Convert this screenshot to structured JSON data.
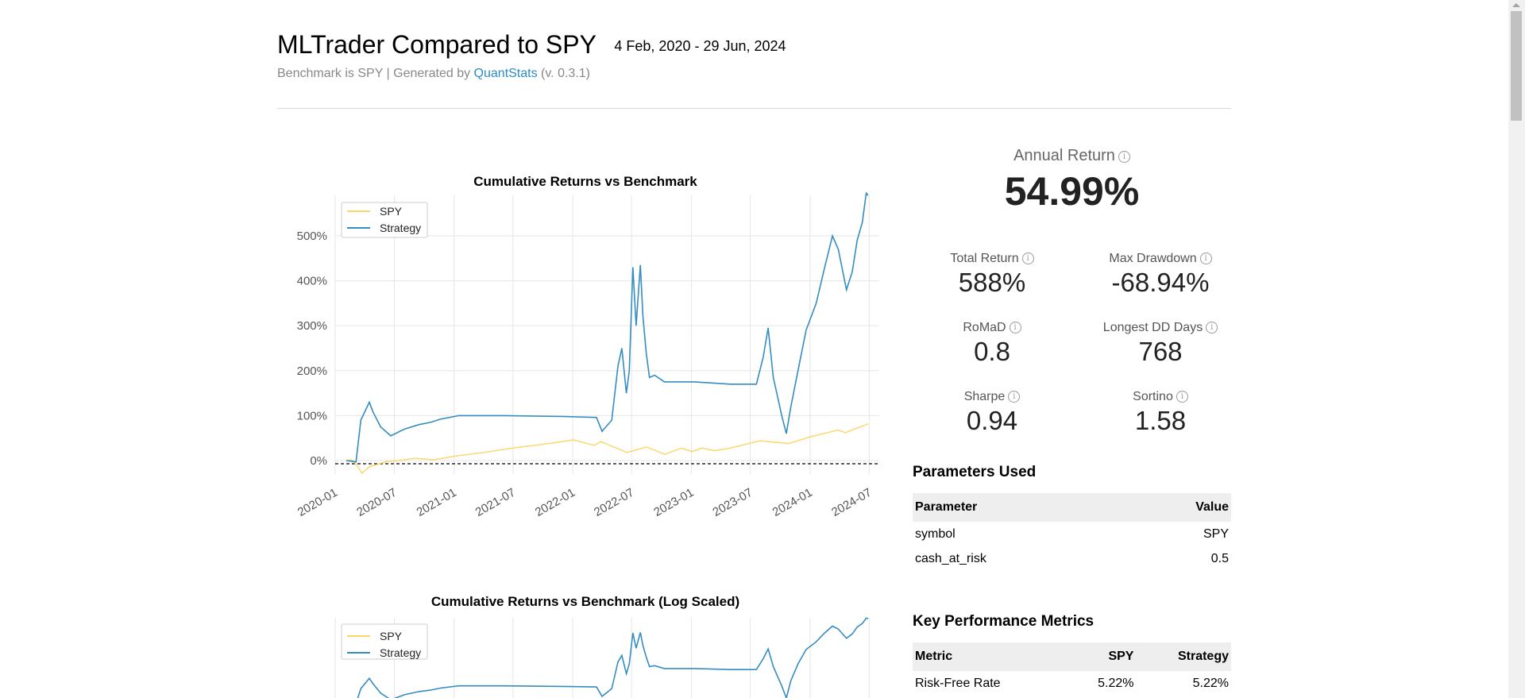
{
  "header": {
    "title": "MLTrader Compared to SPY",
    "date_range": "4 Feb, 2020 - 29 Jun, 2024",
    "subtitle_prefix": "Benchmark is SPY | Generated by ",
    "subtitle_link": "QuantStats",
    "subtitle_suffix": " (v. 0.3.1)"
  },
  "summary": {
    "annual_return": {
      "label": "Annual Return",
      "value": "54.99%"
    },
    "metrics": [
      {
        "label": "Total Return",
        "value": "588%"
      },
      {
        "label": "Max Drawdown",
        "value": "-68.94%"
      },
      {
        "label": "RoMaD",
        "value": "0.8"
      },
      {
        "label": "Longest DD Days",
        "value": "768"
      },
      {
        "label": "Sharpe",
        "value": "0.94"
      },
      {
        "label": "Sortino",
        "value": "1.58"
      }
    ],
    "info_icon": "ⓘ"
  },
  "parameters": {
    "heading": "Parameters Used",
    "columns": [
      "Parameter",
      "Value"
    ],
    "rows": [
      [
        "symbol",
        "SPY"
      ],
      [
        "cash_at_risk",
        "0.5"
      ]
    ]
  },
  "key_metrics": {
    "heading": "Key Performance Metrics",
    "columns": [
      "Metric",
      "SPY",
      "Strategy"
    ],
    "rows": [
      [
        "Risk-Free Rate",
        "5.22%",
        "5.22%"
      ]
    ]
  },
  "colors": {
    "spy": "#fcd565",
    "strategy": "#348dc1",
    "grid": "#e6e6e6"
  },
  "chart_data": [
    {
      "type": "line",
      "title": "Cumulative Returns vs Benchmark",
      "x_tick_labels": [
        "2020-01",
        "2020-07",
        "2021-01",
        "2021-07",
        "2022-01",
        "2022-07",
        "2023-01",
        "2023-07",
        "2024-01",
        "2024-07"
      ],
      "y_tick_labels": [
        "0%",
        "100%",
        "200%",
        "300%",
        "400%",
        "500%"
      ],
      "xlim": [
        "2020-01-01",
        "2024-08-01"
      ],
      "ylim": [
        -30,
        590
      ],
      "legend": "top-left",
      "grid": true,
      "series": [
        {
          "name": "SPY",
          "color": "#fcd565",
          "x": [
            "2020-02-04",
            "2020-02-20",
            "2020-03-10",
            "2020-03-23",
            "2020-04-15",
            "2020-06-08",
            "2020-07-15",
            "2020-09-01",
            "2020-10-30",
            "2021-01-04",
            "2021-04-01",
            "2021-07-01",
            "2021-10-01",
            "2022-01-03",
            "2022-03-08",
            "2022-03-29",
            "2022-06-16",
            "2022-08-16",
            "2022-10-12",
            "2022-12-01",
            "2023-01-03",
            "2023-02-02",
            "2023-03-13",
            "2023-05-01",
            "2023-07-31",
            "2023-10-27",
            "2023-12-29",
            "2024-03-28",
            "2024-04-19",
            "2024-06-28"
          ],
          "values": [
            0,
            2,
            -12,
            -28,
            -14,
            -2,
            0,
            5,
            2,
            10,
            18,
            28,
            36,
            46,
            34,
            42,
            18,
            30,
            14,
            28,
            20,
            28,
            22,
            28,
            44,
            38,
            52,
            68,
            62,
            82
          ]
        },
        {
          "name": "Strategy",
          "color": "#348dc1",
          "x": [
            "2020-02-04",
            "2020-03-05",
            "2020-03-20",
            "2020-04-15",
            "2020-04-25",
            "2020-05-20",
            "2020-06-20",
            "2020-08-01",
            "2020-09-15",
            "2020-10-20",
            "2020-11-20",
            "2021-01-15",
            "2021-06-01",
            "2021-12-01",
            "2022-03-15",
            "2022-04-01",
            "2022-05-01",
            "2022-05-20",
            "2022-06-01",
            "2022-06-15",
            "2022-06-24",
            "2022-07-05",
            "2022-07-15",
            "2022-07-28",
            "2022-08-05",
            "2022-08-15",
            "2022-08-25",
            "2022-09-10",
            "2022-10-10",
            "2023-01-10",
            "2023-05-01",
            "2023-07-20",
            "2023-08-10",
            "2023-08-25",
            "2023-09-10",
            "2023-10-06",
            "2023-10-20",
            "2023-11-03",
            "2023-11-25",
            "2023-12-20",
            "2024-01-20",
            "2024-02-15",
            "2024-03-10",
            "2024-03-28",
            "2024-04-22",
            "2024-05-10",
            "2024-05-25",
            "2024-06-10",
            "2024-06-22",
            "2024-06-28"
          ],
          "values": [
            0,
            -3,
            90,
            130,
            110,
            75,
            55,
            70,
            80,
            85,
            92,
            100,
            100,
            98,
            96,
            65,
            90,
            210,
            250,
            150,
            200,
            430,
            300,
            435,
            320,
            240,
            185,
            190,
            175,
            175,
            170,
            170,
            230,
            295,
            185,
            100,
            60,
            120,
            200,
            290,
            350,
            430,
            500,
            470,
            380,
            420,
            490,
            530,
            595,
            590
          ]
        }
      ]
    },
    {
      "type": "line",
      "title": "Cumulative Returns vs Benchmark (Log Scaled)",
      "legend": "top-left",
      "grid": true,
      "series": [
        {
          "name": "SPY",
          "color": "#fcd565"
        },
        {
          "name": "Strategy",
          "color": "#348dc1"
        }
      ]
    }
  ]
}
